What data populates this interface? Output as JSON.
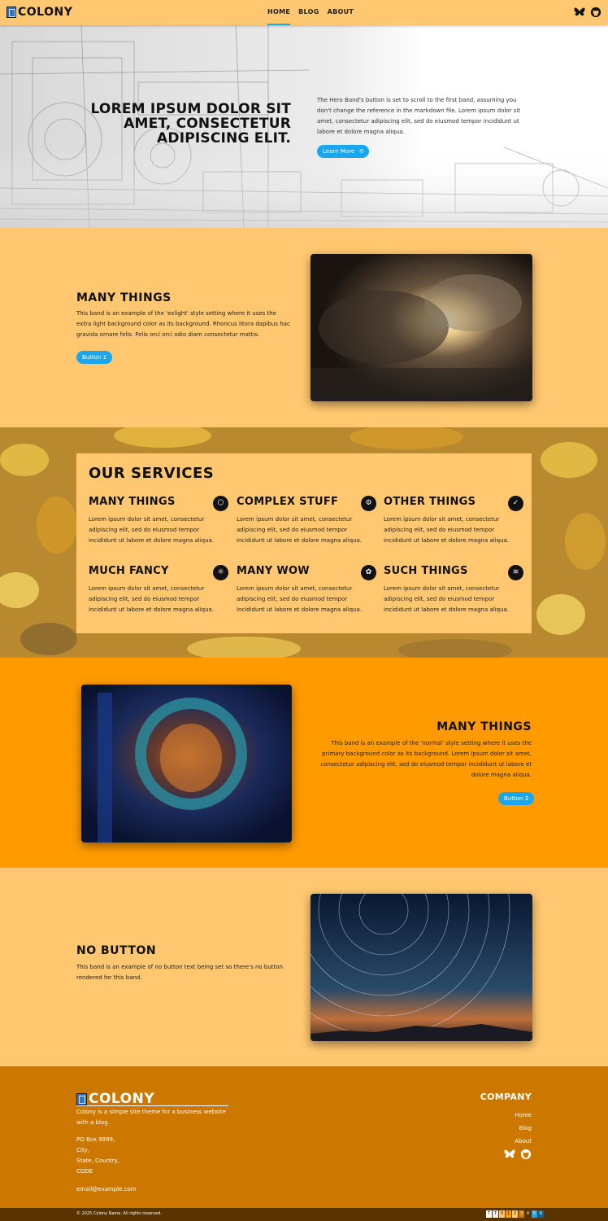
{
  "nav": {
    "logo_text": "COLONY",
    "items": [
      {
        "label": "HOME",
        "active": true
      },
      {
        "label": "BLOG",
        "active": false
      },
      {
        "label": "ABOUT",
        "active": false
      }
    ],
    "icons": [
      "bluesky-icon",
      "github-icon"
    ]
  },
  "hero": {
    "title": "LOREM IPSUM DOLOR SIT AMET, CONSECTETUR ADIPISCING ELIT.",
    "text": "The Hero Band's button is set to scroll to the first band, assuming you don't change the reference in the markdown file. Lorem ipsum dolor sit amet, consectetur adipiscing elit, sed do eiusmod tempor incididunt ut labore et dolore magna aliqua.",
    "button": "Learn More"
  },
  "band1": {
    "title": "MANY THINGS",
    "text": "This band is an example of the 'exlight' style setting where it uses the extra light background color as its background. Rhoncus litora dapibus hac gravida ornare felis. Felis orci orci odio diam consectetur mattis.",
    "button": "Button 1"
  },
  "services": {
    "heading": "OUR SERVICES",
    "items": [
      {
        "title": "MANY THINGS",
        "icon": "cube-icon",
        "text": "Lorem ipsum dolor sit amet, consectetur adipiscing elit, sed do eiusmod tempor incididunt ut labore et dolore magna aliqua."
      },
      {
        "title": "COMPLEX STUFF",
        "icon": "chip-icon",
        "text": "Lorem ipsum dolor sit amet, consectetur adipiscing elit, sed do eiusmod tempor incididunt ut labore et dolore magna aliqua."
      },
      {
        "title": "OTHER THINGS",
        "icon": "check-icon",
        "text": "Lorem ipsum dolor sit amet, consectetur adipiscing elit, sed do eiusmod tempor incididunt ut labore et dolore magna aliqua."
      },
      {
        "title": "MUCH FANCY",
        "icon": "atom-icon",
        "text": "Lorem ipsum dolor sit amet, consectetur adipiscing elit, sed do eiusmod tempor incididunt ut labore et dolore magna aliqua."
      },
      {
        "title": "MANY WOW",
        "icon": "flower-icon",
        "text": "Lorem ipsum dolor sit amet, consectetur adipiscing elit, sed do eiusmod tempor incididunt ut labore et dolore magna aliqua."
      },
      {
        "title": "SUCH THINGS",
        "icon": "layers-icon",
        "text": "Lorem ipsum dolor sit amet, consectetur adipiscing elit, sed do eiusmod tempor incididunt ut labore et dolore magna aliqua."
      }
    ]
  },
  "band3": {
    "title": "MANY THINGS",
    "text": "This band is an example of the 'normal' style setting where it uses the primary background color as its background. Lorem ipsum dolor sit amet, consectetur adipiscing elit, sed do eiusmod tempor incididunt ut labore et dolore magna aliqua.",
    "button": "Button 3"
  },
  "band4": {
    "title": "NO BUTTON",
    "text": "This band is an example of no button text being set so there's no button rendered for this band."
  },
  "footer": {
    "logo_text": "COLONY",
    "tagline": "Colony is a simple site theme for a business website with a blog.",
    "address": [
      "PO Box 9999,",
      "City,",
      "State, Country,",
      "CODE"
    ],
    "email": "email@example.com",
    "company_heading": "COMPANY",
    "links": [
      "Home",
      "Blog",
      "About"
    ],
    "copyright": "© 2025 Colony Name. All rights reserved.",
    "badge_digits": [
      "T",
      "T",
      "0",
      "1",
      "2",
      "3",
      "4",
      "5",
      "6"
    ]
  },
  "colors": {
    "light": "#ffc870",
    "primary": "#ff9b00",
    "dark": "#cc7800",
    "accent": "#1aa7f0"
  }
}
